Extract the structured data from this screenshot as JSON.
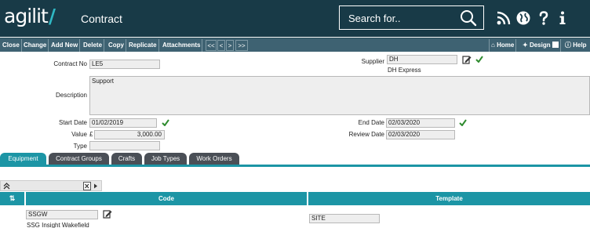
{
  "header": {
    "logo_text": "agilit",
    "logo_slash": "/",
    "title": "Contract",
    "search_placeholder": "Search for.."
  },
  "toolbar": {
    "buttons": [
      "Close",
      "Change",
      "Add New",
      "Delete",
      "Copy",
      "Replicate",
      "Attachments"
    ],
    "nav": [
      "<<",
      "<",
      ">",
      ">>"
    ],
    "home": "Home",
    "design": "Design",
    "help": "Help"
  },
  "form": {
    "contract_no": {
      "label": "Contract No",
      "value": "LE5"
    },
    "supplier": {
      "label": "Supplier",
      "value": "DH",
      "name": "DH Express"
    },
    "description": {
      "label": "Description",
      "value": "Support"
    },
    "start_date": {
      "label": "Start Date",
      "value": "01/02/2019"
    },
    "end_date": {
      "label": "End Date",
      "value": "02/03/2020"
    },
    "value": {
      "label": "Value",
      "currency": "£",
      "value": "3,000.00"
    },
    "review_date": {
      "label": "Review Date",
      "value": "02/03/2020"
    },
    "type": {
      "label": "Type",
      "value": ""
    }
  },
  "tabs": [
    "Equipment",
    "Contract Groups",
    "Crafts",
    "Job Types",
    "Work Orders"
  ],
  "grid": {
    "columns": [
      "Code",
      "Template"
    ],
    "rows": [
      {
        "code": "SSGW",
        "code_name": "SSG Insight Wakefield",
        "template": "SITE"
      }
    ]
  },
  "colors": {
    "header_bg": "#183a47",
    "toolbar_bg": "#3e6272",
    "accent": "#1c95a5",
    "tab_inactive": "#4a4f56",
    "check_green": "#2e8b2e"
  }
}
